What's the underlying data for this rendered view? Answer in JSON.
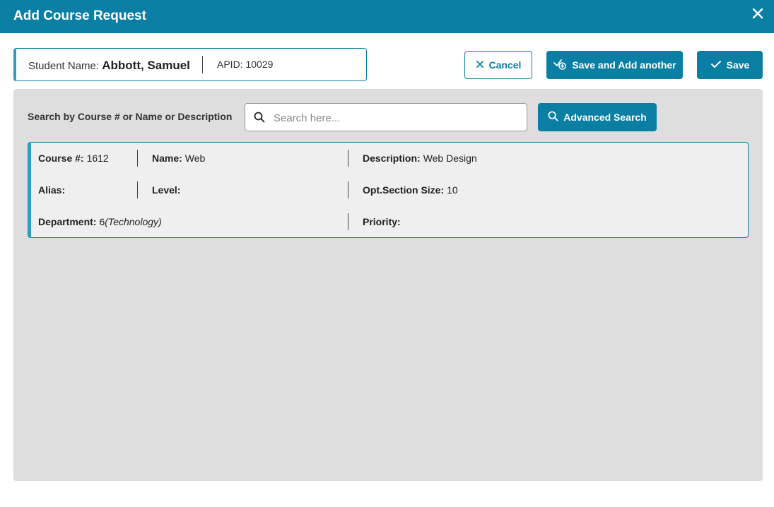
{
  "dialog": {
    "title": "Add Course Request"
  },
  "student": {
    "name_label": "Student Name:",
    "name": "Abbott, Samuel",
    "apid_label": "APID:",
    "apid": "10029"
  },
  "actions": {
    "cancel_label": "Cancel",
    "save_add_label": "Save and Add another",
    "save_label": "Save"
  },
  "search": {
    "label": "Search by Course # or Name or Description",
    "placeholder": "Search here...",
    "value": "",
    "advanced_label": "Advanced Search"
  },
  "course": {
    "course_num_label": "Course #:",
    "course_num": "1612",
    "name_label": "Name:",
    "name": "Web",
    "description_label": "Description:",
    "description": "Web Design",
    "alias_label": "Alias:",
    "alias": "",
    "level_label": "Level:",
    "level": "",
    "opt_section_label": "Opt.Section Size:",
    "opt_section": "10",
    "department_label": "Department:",
    "department_num": "6",
    "department_name": "(Technology)",
    "priority_label": "Priority:",
    "priority": ""
  },
  "colors": {
    "primary": "#0a7fa3",
    "accent": "#2d9cc4",
    "panel_bg": "#dedede",
    "card_bg": "#efefef"
  },
  "icons": {
    "close": "close-icon",
    "cancel": "x-icon",
    "save_add": "check-plus-icon",
    "save": "check-icon",
    "search": "search-icon"
  }
}
